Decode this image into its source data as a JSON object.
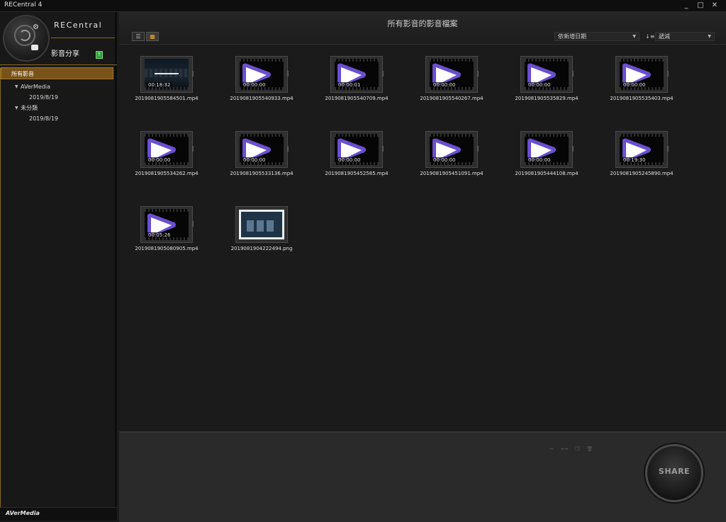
{
  "window": {
    "title": "RECentral 4",
    "controls": [
      "_",
      "□",
      "✕"
    ]
  },
  "sidebar": {
    "brand": "RECentral",
    "section_title": "影音分享",
    "nav_all": "所有影音",
    "tree": [
      {
        "label": "AVerMedia",
        "level": 0,
        "expanded": true
      },
      {
        "label": "2019/8/19",
        "level": 1
      },
      {
        "label": "未分類",
        "level": 0,
        "expanded": true
      },
      {
        "label": "2019/8/19",
        "level": 1
      }
    ],
    "footer_logo": "AVerMedia"
  },
  "header": {
    "title": "所有影音的影音檔案",
    "sort_field": "依新增日期",
    "sort_order": "遞減"
  },
  "files": [
    {
      "name": "2019081905584501.mp4",
      "duration": "00:18:32",
      "thumb": "scene"
    },
    {
      "name": "2019081905540933.mp4",
      "duration": "00:00:00",
      "thumb": "play"
    },
    {
      "name": "2019081905540709.mp4",
      "duration": "00:00:01",
      "thumb": "play"
    },
    {
      "name": "2019081905540267.mp4",
      "duration": "00:00:00",
      "thumb": "play"
    },
    {
      "name": "2019081905535829.mp4",
      "duration": "00:00:00",
      "thumb": "play"
    },
    {
      "name": "2019081905535403.mp4",
      "duration": "00:00:00",
      "thumb": "play"
    },
    {
      "name": "2019081905534262.mp4",
      "duration": "00:00:00",
      "thumb": "play"
    },
    {
      "name": "2019081905533136.mp4",
      "duration": "00:00:00",
      "thumb": "play"
    },
    {
      "name": "2019081905452585.mp4",
      "duration": "00:00:00",
      "thumb": "play"
    },
    {
      "name": "2019081905451091.mp4",
      "duration": "00:00:00",
      "thumb": "play"
    },
    {
      "name": "2019081905444108.mp4",
      "duration": "00:00:00",
      "thumb": "play"
    },
    {
      "name": "2019081905245890.mp4",
      "duration": "00:19:30",
      "thumb": "play"
    },
    {
      "name": "2019081905080905.mp4",
      "duration": "00:05:26",
      "thumb": "play"
    },
    {
      "name": "2019081904222494.png",
      "duration": "",
      "thumb": "image"
    }
  ],
  "footer": {
    "share_label": "SHARE"
  },
  "colors": {
    "accent": "#7a531a",
    "play_purple": "#6a4fd1",
    "active_view": "#f2a51e"
  },
  "icons": [
    "list-view-icon",
    "grid-view-icon",
    "sort-order-icon",
    "upload-icon",
    "cut-icon",
    "merge-icon",
    "copy-icon",
    "delete-icon"
  ]
}
